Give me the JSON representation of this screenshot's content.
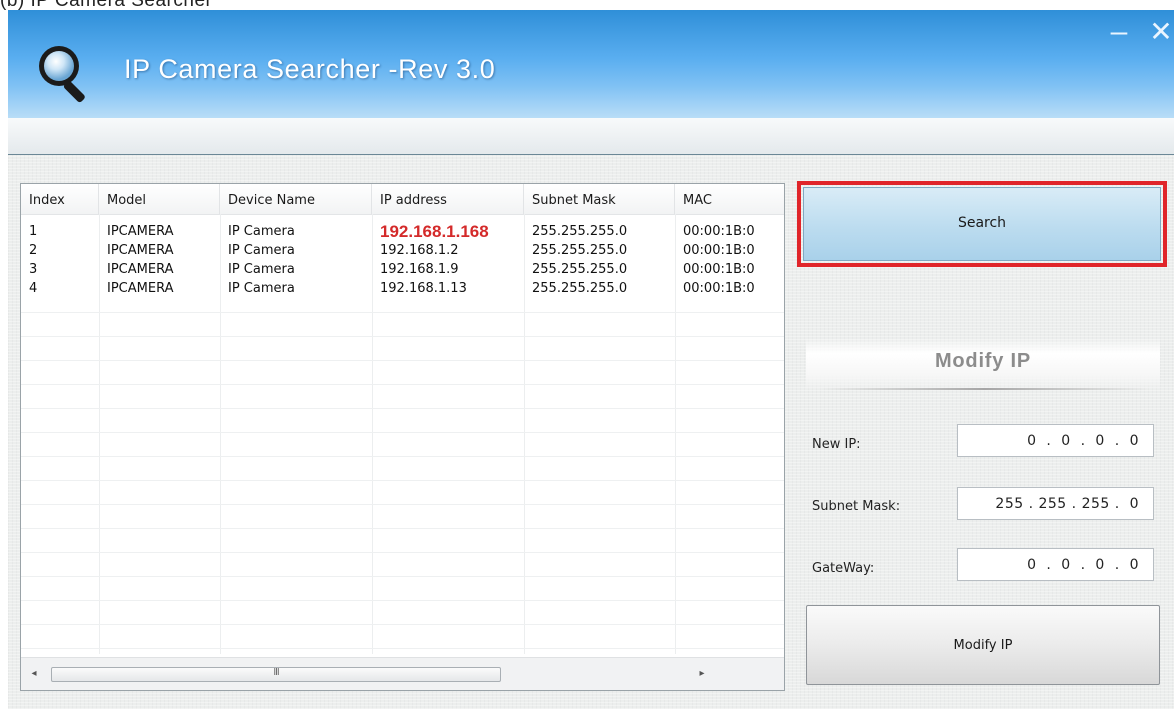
{
  "caption": "(b) IP Camera Searcher",
  "window": {
    "title": "IP Camera Searcher -Rev 3.0",
    "minimize_glyph": "–",
    "close_glyph": "✕",
    "logo_icon": "magnifier-icon"
  },
  "table": {
    "columns": [
      "Index",
      "Model",
      "Device Name",
      "IP address",
      "Subnet Mask",
      "MAC"
    ],
    "rows": [
      [
        "1",
        "IPCAMERA",
        "IP Camera",
        "192.168.1.168",
        "255.255.255.0",
        "00:00:1B:0"
      ],
      [
        "2",
        "IPCAMERA",
        "IP Camera",
        "192.168.1.2",
        "255.255.255.0",
        "00:00:1B:0"
      ],
      [
        "3",
        "IPCAMERA",
        "IP Camera",
        "192.168.1.9",
        "255.255.255.0",
        "00:00:1B:0"
      ],
      [
        "4",
        "IPCAMERA",
        "IP Camera",
        "192.168.1.13",
        "255.255.255.0",
        "00:00:1B:0"
      ]
    ],
    "highlight_color": "#d42a2a",
    "scroll_left": "◂",
    "scroll_right": "▸",
    "scroll_grip": "III"
  },
  "panel": {
    "search_label": "Search",
    "search_highlight_color": "#e0252a",
    "modify_heading": "Modify IP",
    "new_ip_label": "New IP:",
    "new_ip_value": "0  .  0  .  0  .  0",
    "subnet_label": "Subnet Mask:",
    "subnet_value": "255 . 255 . 255 .  0",
    "gateway_label": "GateWay:",
    "gateway_value": "0  .  0  .  0  .  0",
    "modify_button_label": "Modify IP"
  }
}
